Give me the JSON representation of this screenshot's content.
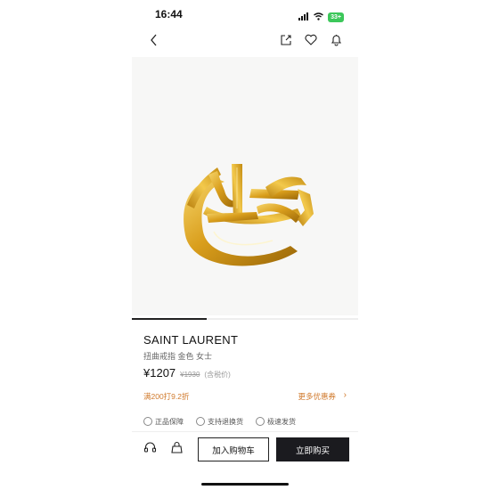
{
  "status_bar": {
    "time": "16:44",
    "battery": "33+"
  },
  "nav": {
    "back_icon": "chevron-left-icon",
    "share_icon": "share-icon",
    "favorite_icon": "heart-icon",
    "notification_icon": "bell-icon"
  },
  "product": {
    "brand": "SAINT LAURENT",
    "subtitle": "扭曲戒指 金色 女士",
    "price": "¥1207",
    "original_price": "¥1930",
    "tax_note": "(含税价)",
    "image_icon": "gold-ring-image",
    "gallery_progress": 0.33
  },
  "promo": {
    "text": "满200打9.2折",
    "coupon_link": "更多优惠券",
    "chevron": "›"
  },
  "services": [
    {
      "label": "正品保障",
      "icon": "shield-icon"
    },
    {
      "label": "支持退换货",
      "icon": "return-icon"
    },
    {
      "label": "极速发货",
      "icon": "delivery-icon"
    }
  ],
  "bottom_bar": {
    "support_icon": "headset-icon",
    "bag_icon": "shopping-bag-icon",
    "add_to_cart": "加入购物车",
    "buy_now": "立即购买"
  },
  "colors": {
    "accent": "#d0792b",
    "buy_button": "#1b1b1f",
    "ring_gold": "#d8a31e"
  }
}
